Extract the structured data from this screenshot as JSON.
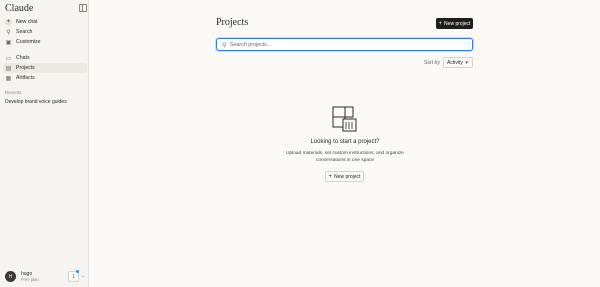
{
  "sidebar": {
    "brand": "Claude",
    "items": [
      {
        "label": "New chat",
        "icon": "plus-icon"
      },
      {
        "label": "Search",
        "icon": "search-icon"
      },
      {
        "label": "Customize",
        "icon": "customize-icon"
      },
      {
        "label": "Chats",
        "icon": "chat-icon"
      },
      {
        "label": "Projects",
        "icon": "folder-icon",
        "active": true
      },
      {
        "label": "Artifacts",
        "icon": "artifacts-icon"
      }
    ],
    "recents_label": "Recents",
    "recents": [
      "Develop brand voice guides"
    ],
    "user": {
      "initial": "H",
      "name": "hugo",
      "plan": "Free plan"
    }
  },
  "main": {
    "title": "Projects",
    "new_project_button": "New project",
    "search_placeholder": "Search projects...",
    "sort_label": "Sort by",
    "sort_value": "Activity",
    "empty": {
      "title": "Looking to start a project?",
      "description": "Upload materials, set custom instructions, and organize conversations in one space",
      "button": "New project"
    }
  },
  "colors": {
    "accent_focus": "#2f7de1",
    "primary_button": "#1f1e1c",
    "background": "#faf9f5",
    "sidebar": "#f5f4ee"
  }
}
